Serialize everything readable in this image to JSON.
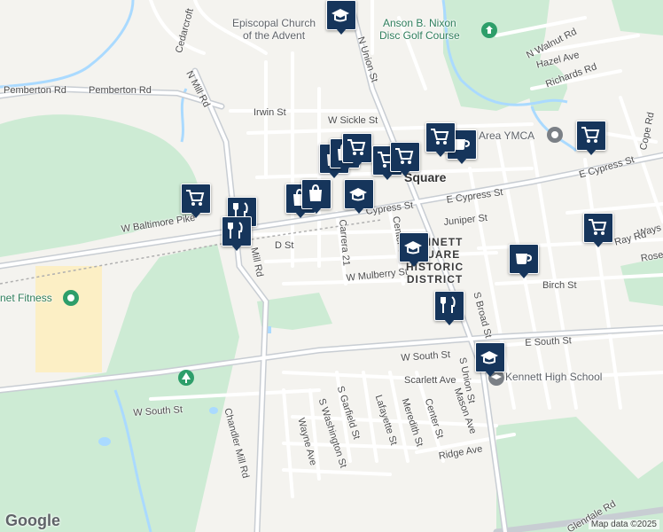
{
  "map": {
    "attribution": "Map data ©2025",
    "logo": "Google",
    "district_label": [
      "KENNETT",
      "SQUARE",
      "HISTORIC",
      "DISTRICT"
    ],
    "town_label": "Square",
    "colors": {
      "background": "#f4f3ef",
      "park": "#cdebd4",
      "water": "#aadaff",
      "major_road": "#c8cdd3",
      "minor_road": "#ffffff",
      "marker": "#16355b",
      "poi_green": "#2e9e6a",
      "poi_gray": "#7b8086"
    }
  },
  "streets": [
    {
      "text": "Cedarcroft",
      "key": "cedarcroft"
    },
    {
      "text": "N Mill Rd",
      "key": "n_mill_rd"
    },
    {
      "text": "Pemberton Rd",
      "key": "pemberton_1"
    },
    {
      "text": "Pemberton Rd",
      "key": "pemberton_2"
    },
    {
      "text": "Irwin St",
      "key": "irwin"
    },
    {
      "text": "W Sickle St",
      "key": "w_sickle"
    },
    {
      "text": "N Union St",
      "key": "n_union"
    },
    {
      "text": "N Walnut Rd",
      "key": "n_walnut"
    },
    {
      "text": "Hazel Ave",
      "key": "hazel"
    },
    {
      "text": "Richards Rd",
      "key": "richards"
    },
    {
      "text": "Cope Rd",
      "key": "cope"
    },
    {
      "text": "E Cypress St",
      "key": "e_cypress_1"
    },
    {
      "text": "E Cypress St",
      "key": "e_cypress_2"
    },
    {
      "text": "Cypress St",
      "key": "w_cypress"
    },
    {
      "text": "W Baltimore Pike",
      "key": "w_baltimore"
    },
    {
      "text": "Juniper St",
      "key": "juniper"
    },
    {
      "text": "D St",
      "key": "d_st"
    },
    {
      "text": "Carrera 21",
      "key": "carrera"
    },
    {
      "text": "Center St",
      "key": "center_n"
    },
    {
      "text": "Mill Rd",
      "key": "mill_rd"
    },
    {
      "text": "W Mulberry St",
      "key": "w_mulberry"
    },
    {
      "text": "Birch St",
      "key": "birch"
    },
    {
      "text": "S Broad St",
      "key": "s_broad"
    },
    {
      "text": "E South St",
      "key": "e_south"
    },
    {
      "text": "W South St",
      "key": "w_south_1"
    },
    {
      "text": "W South St",
      "key": "w_south_2"
    },
    {
      "text": "S Union St",
      "key": "s_union"
    },
    {
      "text": "Scarlett Ave",
      "key": "scarlett"
    },
    {
      "text": "Mason Ave",
      "key": "mason"
    },
    {
      "text": "S Garfield St",
      "key": "s_garfield"
    },
    {
      "text": "Lafayette St",
      "key": "lafayette"
    },
    {
      "text": "Meredith St",
      "key": "meredith"
    },
    {
      "text": "Center St",
      "key": "center_s"
    },
    {
      "text": "S Washington St",
      "key": "s_washington"
    },
    {
      "text": "Wayne Ave",
      "key": "wayne"
    },
    {
      "text": "Ridge Ave",
      "key": "ridge"
    },
    {
      "text": "Chandler Mill Rd",
      "key": "chandler"
    },
    {
      "text": "Ways",
      "key": "ways"
    },
    {
      "text": "Rose",
      "key": "rose"
    },
    {
      "text": "Ray Rd",
      "key": "ray"
    },
    {
      "text": "Glendale Rd",
      "key": "glendale"
    }
  ],
  "pois": {
    "episcopal": [
      "Episcopal Church",
      "of the Advent"
    ],
    "nixon": [
      "Anson B. Nixon",
      "Disc Golf Course"
    ],
    "ymca": "Area YMCA",
    "fitness": "net Fitness",
    "high_school": "Kennett High School"
  },
  "markers": [
    {
      "icon": "school"
    },
    {
      "icon": "cart"
    },
    {
      "icon": "dining"
    },
    {
      "icon": "dining"
    },
    {
      "icon": "bag"
    },
    {
      "icon": "bag"
    },
    {
      "icon": "school"
    },
    {
      "icon": "bag"
    },
    {
      "icon": "bag"
    },
    {
      "icon": "cart"
    },
    {
      "icon": "cart"
    },
    {
      "icon": "cart"
    },
    {
      "icon": "coffee"
    },
    {
      "icon": "cart"
    },
    {
      "icon": "school"
    },
    {
      "icon": "dining"
    },
    {
      "icon": "coffee"
    },
    {
      "icon": "cart"
    },
    {
      "icon": "school"
    },
    {
      "icon": "cart"
    }
  ]
}
